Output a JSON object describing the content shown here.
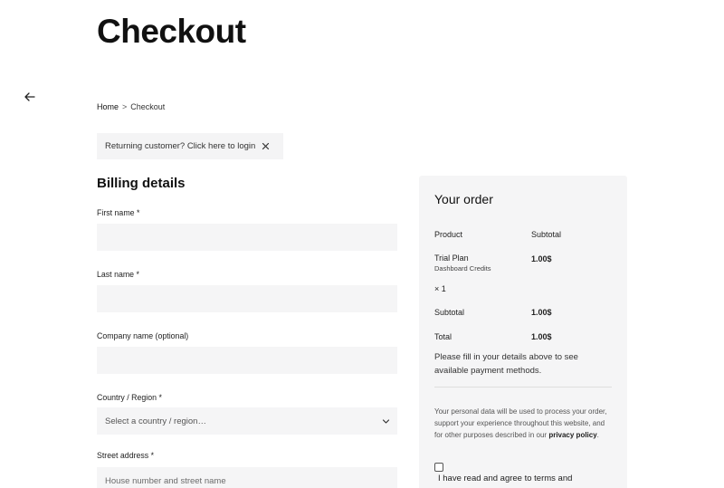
{
  "page": {
    "title": "Checkout"
  },
  "breadcrumb": {
    "home": "Home",
    "separator": ">",
    "current": "Checkout"
  },
  "notice": {
    "text": "Returning customer? Click here to login"
  },
  "billing": {
    "title": "Billing details",
    "first_name_label": "First name *",
    "last_name_label": "Last name *",
    "company_label": "Company name (optional)",
    "country_label": "Country / Region *",
    "country_placeholder": "Select a country / region…",
    "street_label": "Street address *",
    "street_placeholder": "House number and street name"
  },
  "order": {
    "title": "Your order",
    "col_product": "Product",
    "col_subtotal": "Subtotal",
    "item_name": "Trial Plan",
    "item_sub": "Dashboard Credits",
    "item_qty": "× 1",
    "item_price": "1.00$",
    "subtotal_label": "Subtotal",
    "subtotal_value": "1.00$",
    "total_label": "Total",
    "total_value": "1.00$",
    "payment_msg": "Please fill in your details above to see available payment methods.",
    "privacy_text": "Your personal data will be used to process your order, support your experience throughout this website, and for other purposes described in our",
    "privacy_link": "privacy policy",
    "privacy_end": ".",
    "terms_text": "I have read and agree to  terms and"
  }
}
